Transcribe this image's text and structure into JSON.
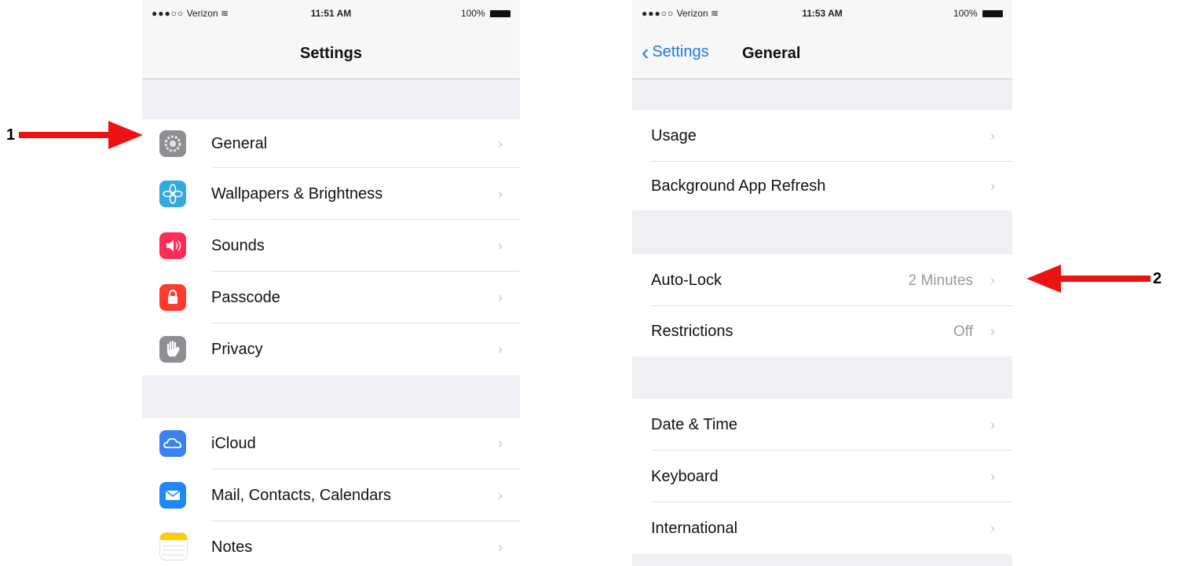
{
  "annotations": [
    {
      "number": "1",
      "target": "General row"
    },
    {
      "number": "2",
      "target": "Auto-Lock row"
    }
  ],
  "left_screen": {
    "status_bar": {
      "carrier": "Verizon",
      "time": "11:51 AM",
      "battery": "100%"
    },
    "nav_title": "Settings",
    "rows": [
      {
        "label": "General",
        "icon": "gear-icon",
        "icon_color": "#8e8e93"
      },
      {
        "label": "Wallpapers & Brightness",
        "icon": "flower-icon",
        "icon_color": "#34aadc"
      },
      {
        "label": "Sounds",
        "icon": "speaker-icon",
        "icon_color": "#ff2d55"
      },
      {
        "label": "Passcode",
        "icon": "lock-icon",
        "icon_color": "#ff3b30"
      },
      {
        "label": "Privacy",
        "icon": "hand-icon",
        "icon_color": "#8e8e93"
      },
      {
        "label": "iCloud",
        "icon": "cloud-icon",
        "icon_color": "#3b82f0"
      },
      {
        "label": "Mail, Contacts, Calendars",
        "icon": "envelope-icon",
        "icon_color": "#1e88f5"
      },
      {
        "label": "Notes",
        "icon": "notes-icon",
        "icon_color": "#ffcc00"
      }
    ]
  },
  "right_screen": {
    "status_bar": {
      "carrier": "Verizon",
      "time": "11:53 AM",
      "battery": "100%"
    },
    "back_label": "Settings",
    "nav_title": "General",
    "rows": [
      {
        "label": "Usage",
        "value": ""
      },
      {
        "label": "Background App Refresh",
        "value": ""
      },
      {
        "label": "Auto-Lock",
        "value": "2 Minutes"
      },
      {
        "label": "Restrictions",
        "value": "Off"
      },
      {
        "label": "Date & Time",
        "value": ""
      },
      {
        "label": "Keyboard",
        "value": ""
      },
      {
        "label": "International",
        "value": ""
      }
    ]
  },
  "colors": {
    "arrow": "#ee1111",
    "ios_blue": "#1a7ae8",
    "group_background": "#efeff4"
  }
}
